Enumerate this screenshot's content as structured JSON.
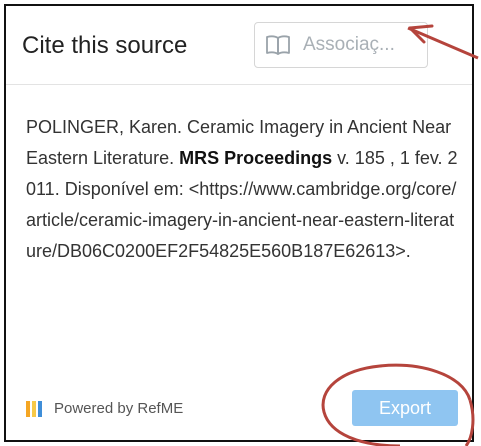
{
  "header": {
    "title": "Cite this source",
    "style_select": {
      "value": "Associaç...",
      "icon": "book-icon"
    }
  },
  "citation": {
    "part1": "POLINGER, Karen. Ceramic Imagery in Ancient Near Eastern Literature. ",
    "journal": "MRS Proceedings",
    "part2": " v. 185 , 1 fev. 2011. Disponível em: <https://www.cambridge.org/core/article/ceramic-imagery-in-ancient-near-eastern-literature/DB06C0200EF2F54825E560B187E62613>."
  },
  "footer": {
    "powered_by": "Powered by RefME",
    "logo_colors": [
      "#f5a623",
      "#f7c948",
      "#3f8ed8"
    ],
    "export_label": "Export"
  },
  "colors": {
    "export_button": "#8fc5f1",
    "annotation": "#b5443c"
  }
}
